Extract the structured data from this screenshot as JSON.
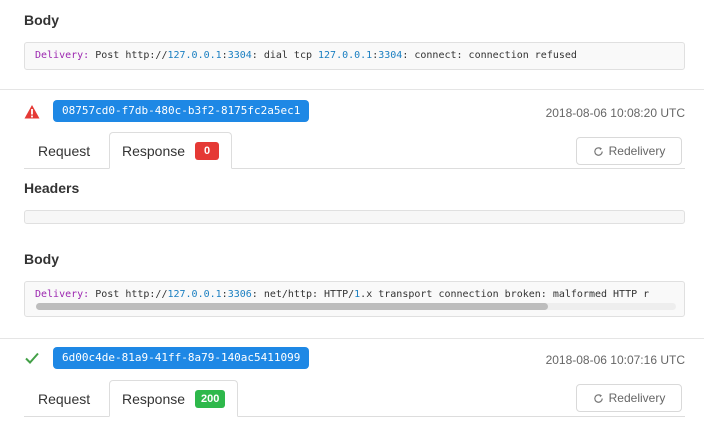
{
  "top_section": {
    "body_title": "Body",
    "body_log": {
      "prefix": "Delivery:",
      "method": "Post http://",
      "ip1": "127.0.0.1",
      "colon1": ":",
      "port1": "3304",
      "mid": ": dial tcp ",
      "ip2": "127.0.0.1",
      "colon2": ":",
      "port2": "3304",
      "tail": ": connect: connection refused"
    }
  },
  "deliveries": [
    {
      "status": "failed",
      "status_icon": "warning-triangle-icon",
      "status_color": "#e53935",
      "id": "08757cd0-f7db-480c-b3f2-8175fc2a5ec1",
      "timestamp": "2018-08-06 10:08:20 UTC",
      "tabs": {
        "request": "Request",
        "response": "Response",
        "response_code": "0",
        "code_color": "#e53935"
      },
      "redeliver_label": "Redelivery",
      "headers_title": "Headers",
      "body_title": "Body",
      "body_log": {
        "prefix": "Delivery:",
        "method": "Post http://",
        "ip": "127.0.0.1",
        "colon": ":",
        "port": "3306",
        "mid": ": net/http: HTTP/",
        "ver": "1",
        "tail": ".x transport connection broken: malformed HTTP r"
      },
      "scroll_fraction": 0.8
    },
    {
      "status": "success",
      "status_icon": "check-icon",
      "status_color": "#43a047",
      "id": "6d00c4de-81a9-41ff-8a79-140ac5411099",
      "timestamp": "2018-08-06 10:07:16 UTC",
      "tabs": {
        "request": "Request",
        "response": "Response",
        "response_code": "200",
        "code_color": "#2eb84b"
      },
      "redeliver_label": "Redelivery"
    }
  ],
  "colors": {
    "accent": "#1e88e5",
    "key": "#9c27b0",
    "number": "#1a7fc1"
  }
}
